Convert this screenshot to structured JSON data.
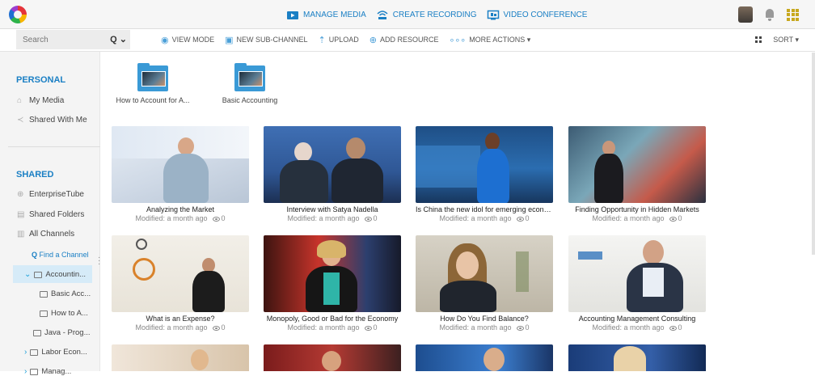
{
  "topnav": {
    "manage_media": "MANAGE MEDIA",
    "create_recording": "CREATE RECORDING",
    "video_conference": "VIDEO CONFERENCE"
  },
  "toolbar": {
    "search_placeholder": "Search",
    "search_button": "Q ⌄",
    "view_mode": "VIEW MODE",
    "new_subchannel": "NEW SUB-CHANNEL",
    "upload": "UPLOAD",
    "add_resource": "ADD RESOURCE",
    "more_actions": "MORE ACTIONS ▾",
    "sort": "SORT ▾"
  },
  "sidebar": {
    "personal_title": "PERSONAL",
    "my_media": "My Media",
    "shared_with_me": "Shared With Me",
    "shared_title": "SHARED",
    "enterprise_tube": "EnterpriseTube",
    "shared_folders": "Shared Folders",
    "all_channels": "All Channels",
    "find_channel": "Find a Channel",
    "tree": [
      "Accountin...",
      "Basic Acc...",
      "How to A...",
      "Java - Prog...",
      "Labor Econ...",
      "Manag..."
    ]
  },
  "folders": [
    {
      "label": "How to Account for A..."
    },
    {
      "label": "Basic Accounting"
    }
  ],
  "videos": [
    {
      "title": "Analyzing the Market",
      "modified": "Modified: a month ago",
      "views": "0"
    },
    {
      "title": "Interview with Satya Nadella",
      "modified": "Modified: a month ago",
      "views": "0"
    },
    {
      "title": "Is China the new idol for emerging econo...",
      "modified": "Modified: a month ago",
      "views": "0"
    },
    {
      "title": "Finding Opportunity in Hidden Markets",
      "modified": "Modified: a month ago",
      "views": "0"
    },
    {
      "title": "What is an Expense?",
      "modified": "Modified: a month ago",
      "views": "0"
    },
    {
      "title": "Monopoly, Good or Bad for the Economy",
      "modified": "Modified: a month ago",
      "views": "0"
    },
    {
      "title": "How Do You Find Balance?",
      "modified": "Modified: a month ago",
      "views": "0"
    },
    {
      "title": "Accounting Management Consulting",
      "modified": "Modified: a month ago",
      "views": "0"
    }
  ],
  "colors": {
    "accent": "#1a7fc4",
    "folder": "#3a9ad6",
    "selected": "#d6ebf8"
  }
}
